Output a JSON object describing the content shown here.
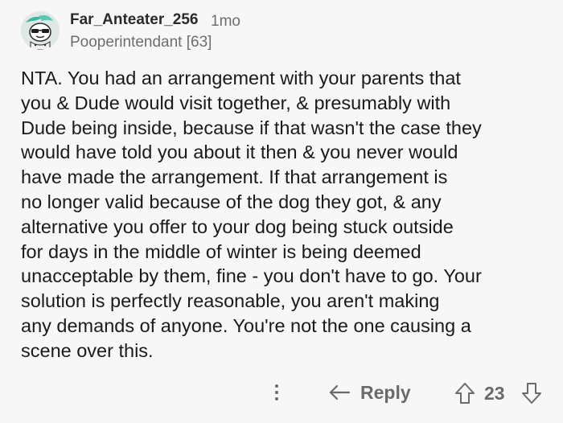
{
  "comment": {
    "username": "Far_Anteater_256",
    "time": "1mo",
    "flair": "Pooperintendant [63]",
    "body": "NTA. You had an arrangement with your parents that\nyou & Dude would visit together, & presumably with\nDude being inside, because if that wasn't the case they\nwould have told you about it then & you never would\nhave made the arrangement. If that arrangement is\nno longer valid because of the dog they got, & any\nalternative you offer to your dog being stuck outside\nfor days in the middle of winter is being deemed\nunacceptable by them, fine - you don't have to go. Your\nsolution is perfectly reasonable, you aren't making\nany demands of anyone. You're not the one causing a\nscene over this."
  },
  "actions": {
    "more_icon": "vertical-ellipsis-icon",
    "reply_icon": "reply-arrow-icon",
    "reply_label": "Reply",
    "upvote_icon": "upvote-arrow-icon",
    "vote_count": "23",
    "downvote_icon": "downvote-arrow-icon"
  },
  "colors": {
    "background": "#f7f7f7",
    "text": "#1a1a1a",
    "muted": "#6d6d6d"
  }
}
